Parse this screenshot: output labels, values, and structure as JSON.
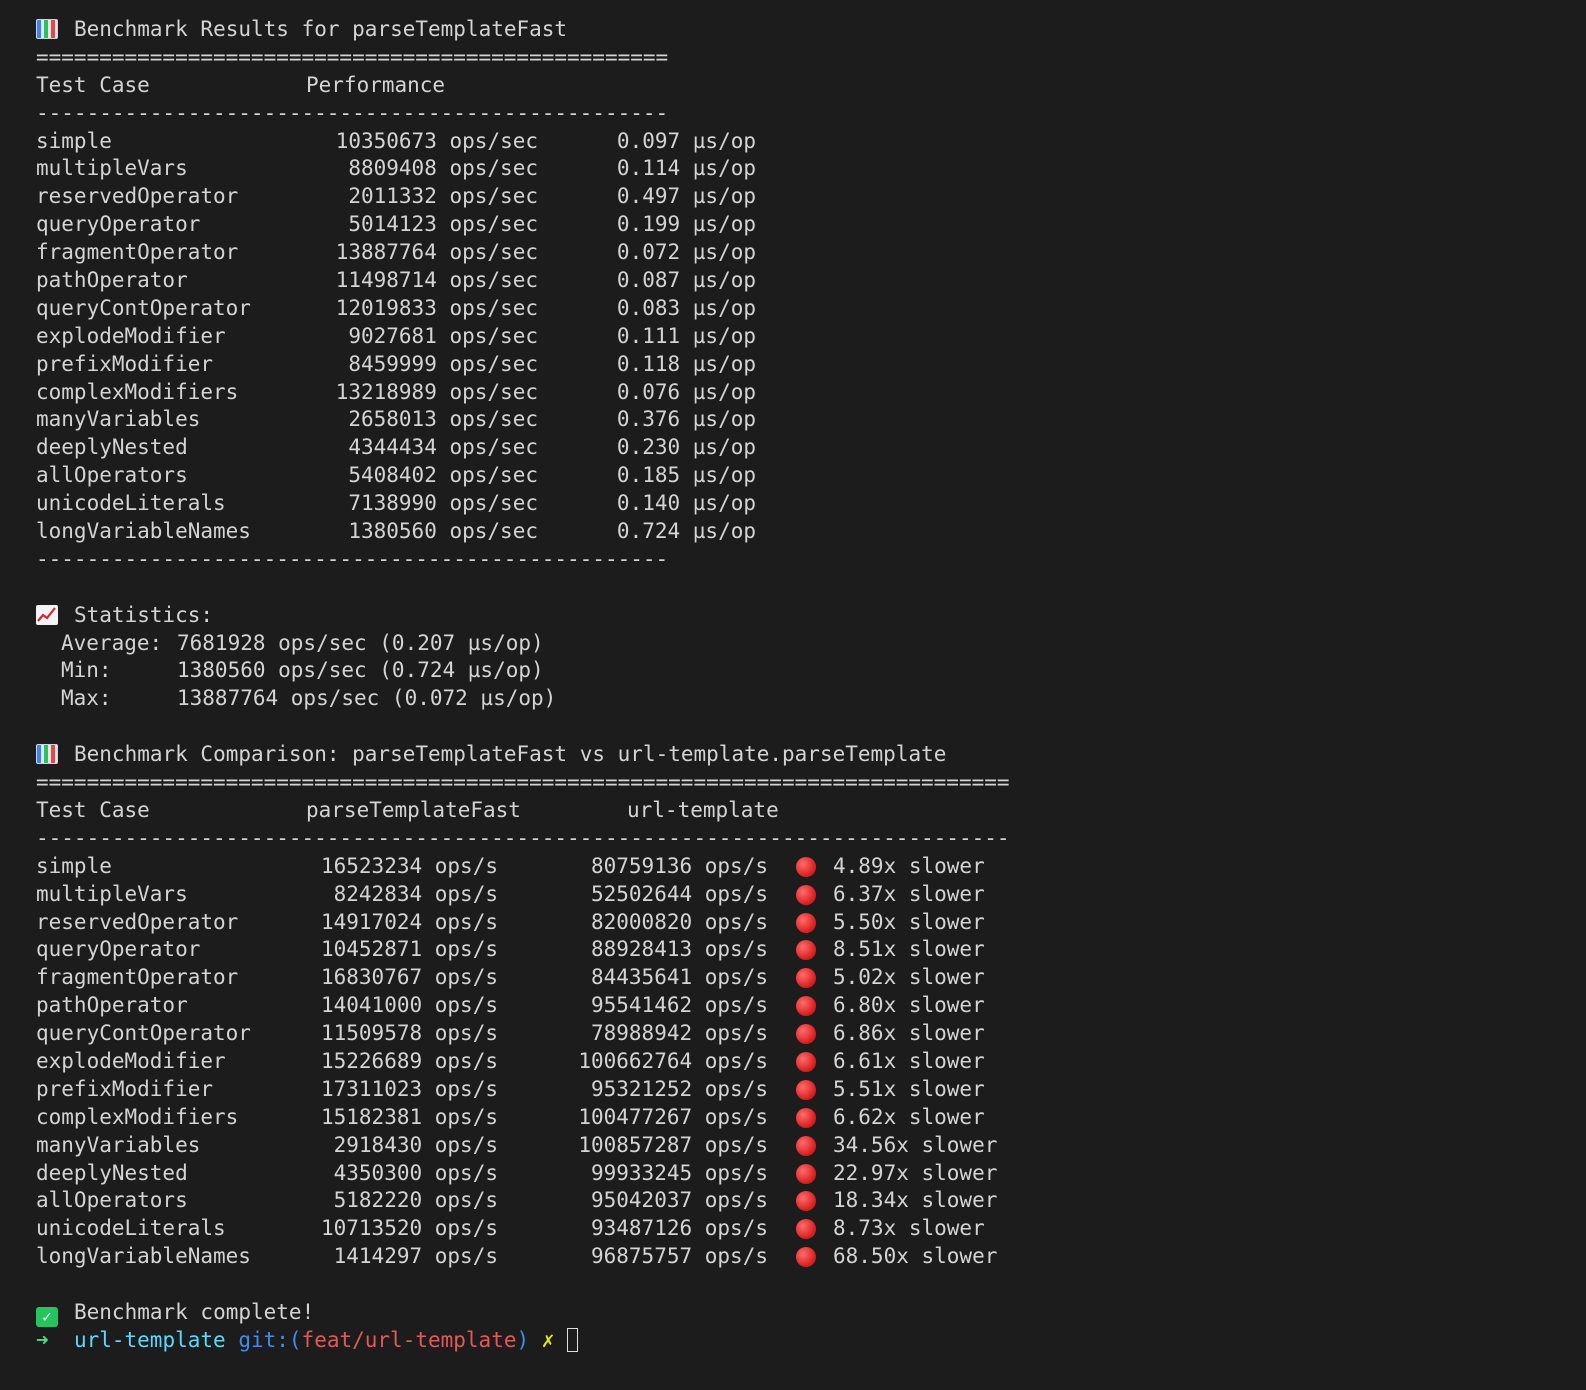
{
  "results": {
    "title": "Benchmark Results for parseTemplateFast",
    "title_icon": "bar-chart-icon",
    "separator_double": "==================================================",
    "separator_single": "--------------------------------------------------",
    "headers": [
      "Test Case",
      "Performance"
    ],
    "rows": [
      {
        "name": "simple",
        "ops": "10350673 ops/sec",
        "time": "0.097 µs/op"
      },
      {
        "name": "multipleVars",
        "ops": "8809408 ops/sec",
        "time": "0.114 µs/op"
      },
      {
        "name": "reservedOperator",
        "ops": "2011332 ops/sec",
        "time": "0.497 µs/op"
      },
      {
        "name": "queryOperator",
        "ops": "5014123 ops/sec",
        "time": "0.199 µs/op"
      },
      {
        "name": "fragmentOperator",
        "ops": "13887764 ops/sec",
        "time": "0.072 µs/op"
      },
      {
        "name": "pathOperator",
        "ops": "11498714 ops/sec",
        "time": "0.087 µs/op"
      },
      {
        "name": "queryContOperator",
        "ops": "12019833 ops/sec",
        "time": "0.083 µs/op"
      },
      {
        "name": "explodeModifier",
        "ops": "9027681 ops/sec",
        "time": "0.111 µs/op"
      },
      {
        "name": "prefixModifier",
        "ops": "8459999 ops/sec",
        "time": "0.118 µs/op"
      },
      {
        "name": "complexModifiers",
        "ops": "13218989 ops/sec",
        "time": "0.076 µs/op"
      },
      {
        "name": "manyVariables",
        "ops": "2658013 ops/sec",
        "time": "0.376 µs/op"
      },
      {
        "name": "deeplyNested",
        "ops": "4344434 ops/sec",
        "time": "0.230 µs/op"
      },
      {
        "name": "allOperators",
        "ops": "5408402 ops/sec",
        "time": "0.185 µs/op"
      },
      {
        "name": "unicodeLiterals",
        "ops": "7138990 ops/sec",
        "time": "0.140 µs/op"
      },
      {
        "name": "longVariableNames",
        "ops": "1380560 ops/sec",
        "time": "0.724 µs/op"
      }
    ]
  },
  "statistics": {
    "title": "Statistics:",
    "title_icon": "trend-chart-icon",
    "rows": [
      {
        "label": "Average:",
        "value": "7681928 ops/sec (0.207 µs/op)"
      },
      {
        "label": "Min:",
        "value": "1380560 ops/sec (0.724 µs/op)"
      },
      {
        "label": "Max:",
        "value": "13887764 ops/sec (0.072 µs/op)"
      }
    ]
  },
  "comparison": {
    "title": "Benchmark Comparison: parseTemplateFast vs url-template.parseTemplate",
    "title_icon": "bar-chart-icon",
    "separator_double": "=============================================================================",
    "separator_single": "-----------------------------------------------------------------------------",
    "headers": [
      "Test Case",
      "parseTemplateFast",
      "url-template"
    ],
    "status_icon": "red-circle-icon",
    "rows": [
      {
        "name": "simple",
        "fast": "16523234 ops/s",
        "url": "80759136 ops/s",
        "ratio": "4.89x slower"
      },
      {
        "name": "multipleVars",
        "fast": "8242834 ops/s",
        "url": "52502644 ops/s",
        "ratio": "6.37x slower"
      },
      {
        "name": "reservedOperator",
        "fast": "14917024 ops/s",
        "url": "82000820 ops/s",
        "ratio": "5.50x slower"
      },
      {
        "name": "queryOperator",
        "fast": "10452871 ops/s",
        "url": "88928413 ops/s",
        "ratio": "8.51x slower"
      },
      {
        "name": "fragmentOperator",
        "fast": "16830767 ops/s",
        "url": "84435641 ops/s",
        "ratio": "5.02x slower"
      },
      {
        "name": "pathOperator",
        "fast": "14041000 ops/s",
        "url": "95541462 ops/s",
        "ratio": "6.80x slower"
      },
      {
        "name": "queryContOperator",
        "fast": "11509578 ops/s",
        "url": "78988942 ops/s",
        "ratio": "6.86x slower"
      },
      {
        "name": "explodeModifier",
        "fast": "15226689 ops/s",
        "url": "100662764 ops/s",
        "ratio": "6.61x slower"
      },
      {
        "name": "prefixModifier",
        "fast": "17311023 ops/s",
        "url": "95321252 ops/s",
        "ratio": "5.51x slower"
      },
      {
        "name": "complexModifiers",
        "fast": "15182381 ops/s",
        "url": "100477267 ops/s",
        "ratio": "6.62x slower"
      },
      {
        "name": "manyVariables",
        "fast": "2918430 ops/s",
        "url": "100857287 ops/s",
        "ratio": "34.56x slower"
      },
      {
        "name": "deeplyNested",
        "fast": "4350300 ops/s",
        "url": "99933245 ops/s",
        "ratio": "22.97x slower"
      },
      {
        "name": "allOperators",
        "fast": "5182220 ops/s",
        "url": "95042037 ops/s",
        "ratio": "18.34x slower"
      },
      {
        "name": "unicodeLiterals",
        "fast": "10713520 ops/s",
        "url": "93487126 ops/s",
        "ratio": "8.73x slower"
      },
      {
        "name": "longVariableNames",
        "fast": "1414297 ops/s",
        "url": "96875757 ops/s",
        "ratio": "68.50x slower"
      }
    ]
  },
  "complete": {
    "text": "Benchmark complete!",
    "icon": "check-mark-icon"
  },
  "prompt": {
    "arrow": "➜",
    "directory": "url-template",
    "git_label": "git:(",
    "branch": "feat/url-template",
    "git_close": ")",
    "dirty_marker": "✗"
  },
  "colors": {
    "background": "#1c1c1c",
    "text": "#d4d4d4",
    "prompt_arrow": "#4ade80",
    "prompt_directory": "#5fd7ff",
    "prompt_git": "#3b8eea",
    "prompt_branch": "#e05a5a",
    "prompt_dirty": "#e5e510",
    "status_slower": "#d81b1b"
  }
}
